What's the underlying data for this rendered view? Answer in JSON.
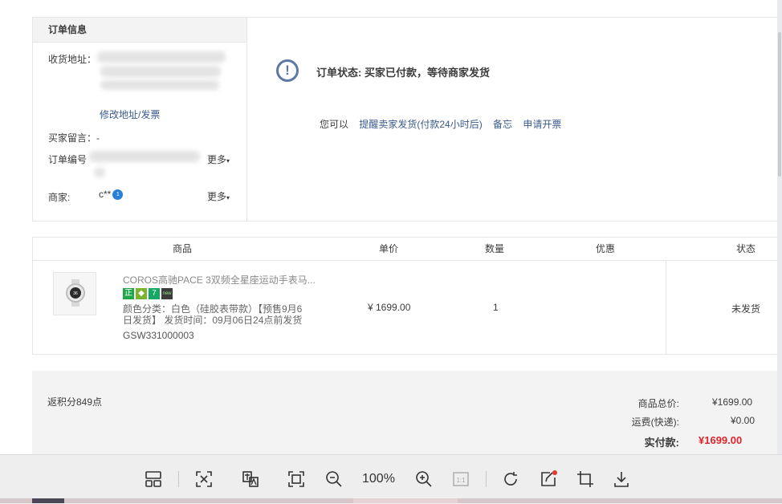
{
  "order_info": {
    "title": "订单信息",
    "address_label": "收货地址：",
    "modify_link": "修改地址/发票",
    "buyer_message_label": "买家留言：",
    "buyer_message_value": "-",
    "order_number_label": "订单编号",
    "more_label": "更多",
    "seller_label": "商家:",
    "seller_value": "c**",
    "seller_more_label": "更多"
  },
  "status": {
    "text": "订单状态: 买家已付款，等待商家发货",
    "you_can": "您可以",
    "action_remind": "提醒卖家发货(付款24小时后)",
    "action_note": "备忘",
    "action_invoice": "申请开票"
  },
  "table": {
    "headers": {
      "goods": "商品",
      "unit_price": "单价",
      "quantity": "数量",
      "discount": "优惠",
      "state": "状态"
    },
    "item": {
      "name": "COROS高驰PACE 3双频全星座运动手表马...",
      "tags": [
        {
          "label": "正",
          "color": "#1fa64a"
        },
        {
          "label": "",
          "color": "#7bb32e"
        },
        {
          "label": "7",
          "color": "#15a865"
        },
        {
          "label": "",
          "color": "#3c3c3c"
        }
      ],
      "sku_line1": "颜色分类：白色（硅胶表带款）【预售9月6",
      "sku_line2": "日发货】 发货时间：09月06日24点前发货",
      "code": "GSW331000003",
      "price": "¥ 1699.00",
      "quantity": "1",
      "state": "未发货"
    }
  },
  "totals": {
    "points": "返积分849点",
    "goods_total_label": "商品总价:",
    "goods_total_value": "¥1699.00",
    "shipping_label": "运费(快递):",
    "shipping_value": "¥0.00",
    "paid_label": "实付款:",
    "paid_value": "¥1699.00"
  },
  "toolbar": {
    "zoom": "100%"
  }
}
